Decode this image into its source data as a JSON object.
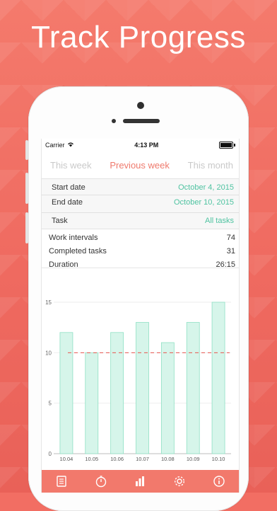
{
  "headline": "Track Progress",
  "status": {
    "carrier": "Carrier",
    "time": "4:13 PM"
  },
  "tabs": [
    {
      "label": "This week",
      "active": false
    },
    {
      "label": "Previous week",
      "active": true
    },
    {
      "label": "This month",
      "active": false
    }
  ],
  "filters": {
    "start_label": "Start date",
    "start_value": "October 4, 2015",
    "end_label": "End date",
    "end_value": "October 10, 2015",
    "task_label": "Task",
    "task_value": "All tasks"
  },
  "stats": {
    "work_intervals_label": "Work intervals",
    "work_intervals_value": "74",
    "completed_label": "Completed tasks",
    "completed_value": "31",
    "duration_label": "Duration",
    "duration_value": "26:15"
  },
  "toolbar": {
    "icons": [
      "tasks-icon",
      "timer-icon",
      "stats-icon",
      "settings-icon",
      "info-icon"
    ]
  },
  "colors": {
    "accent": "#ef7a6d",
    "green": "#4fc3a1",
    "bar_fill": "#d6f5ea",
    "bar_stroke": "#8fe0c4",
    "goal_line": "#e8574f"
  },
  "chart_data": {
    "type": "bar",
    "categories": [
      "10.04",
      "10.05",
      "10.06",
      "10.07",
      "10.08",
      "10.09",
      "10.10"
    ],
    "values": [
      12,
      10,
      12,
      13,
      11,
      13,
      15
    ],
    "ylim": [
      0,
      15
    ],
    "yticks": [
      0,
      5,
      10,
      15
    ],
    "goal_line": 10,
    "grid": true
  }
}
